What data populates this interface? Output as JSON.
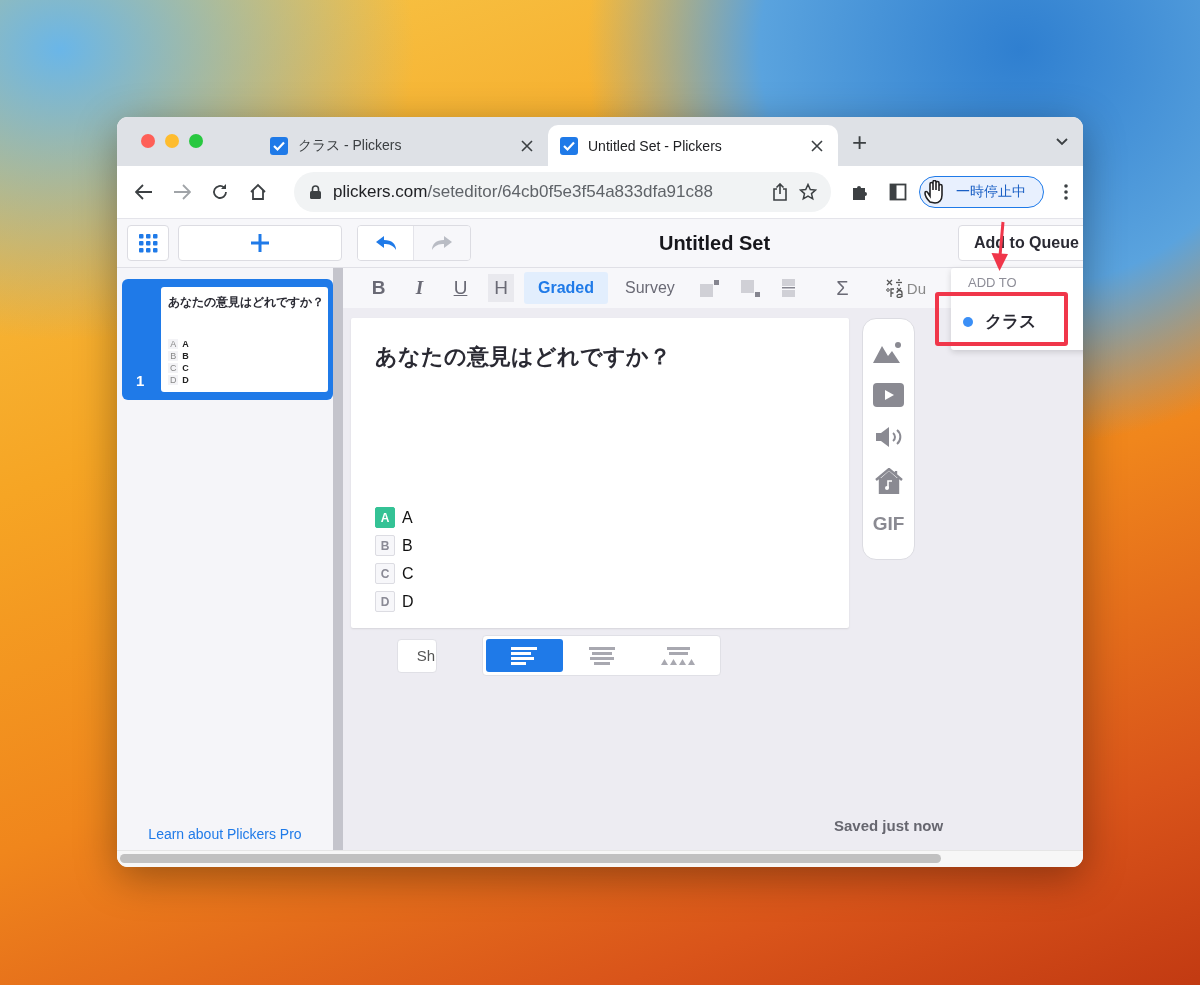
{
  "browser": {
    "tabs": [
      {
        "title": "クラス - Plickers",
        "selected": false
      },
      {
        "title": "Untitled Set - Plickers",
        "selected": true
      }
    ],
    "new_tab": "+",
    "address": {
      "host": "plickers.com",
      "path": "/seteditor/64cb0f5e3f54a833dfa91c88"
    },
    "pause_button": "一時停止中"
  },
  "header": {
    "title": "Untitled Set",
    "add_to_queue": "Add to Queue"
  },
  "sidebar": {
    "slides": [
      {
        "number": "1",
        "question": "あなたの意見はどれですか？",
        "selected": true,
        "choices": [
          {
            "letter": "A",
            "text": "A"
          },
          {
            "letter": "B",
            "text": "B"
          },
          {
            "letter": "C",
            "text": "C"
          },
          {
            "letter": "D",
            "text": "D"
          }
        ]
      }
    ],
    "pro_link": "Learn about Plickers Pro"
  },
  "toolbar": {
    "format_buttons": [
      {
        "label": "B",
        "kind": "bold"
      },
      {
        "label": "I",
        "kind": "italic"
      },
      {
        "label": "U",
        "kind": "underline"
      },
      {
        "label": "H",
        "kind": "heading"
      }
    ],
    "modes": [
      {
        "label": "Graded",
        "selected": true
      },
      {
        "label": "Survey",
        "selected": false
      }
    ],
    "math_button": "Σ",
    "cut_label": "Du"
  },
  "slide": {
    "question": "あなたの意見はどれですか？",
    "choices": [
      {
        "letter": "A",
        "text": "A",
        "correct": true
      },
      {
        "letter": "B",
        "text": "B",
        "correct": false
      },
      {
        "letter": "C",
        "text": "C",
        "correct": false
      },
      {
        "letter": "D",
        "text": "D",
        "correct": false
      }
    ]
  },
  "media_panel": {
    "gif_label": "GIF"
  },
  "show_button": "Sh",
  "layout_options": [
    {
      "kind": "left",
      "selected": true
    },
    {
      "kind": "center",
      "selected": false
    },
    {
      "kind": "choices",
      "selected": false
    }
  ],
  "status": "Saved just now",
  "add_to_menu": {
    "heading": "ADD TO",
    "items": [
      {
        "label": "クラス",
        "color": "#3b8ff6"
      }
    ]
  }
}
